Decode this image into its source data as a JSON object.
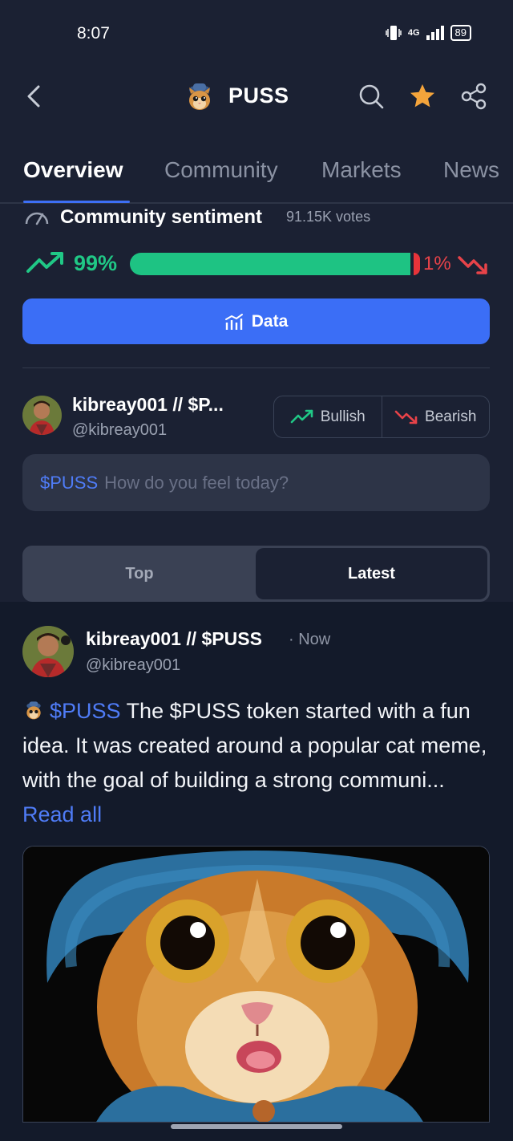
{
  "status_bar": {
    "time": "8:07",
    "network": "4G",
    "battery": "89"
  },
  "header": {
    "coin_name": "PUSS"
  },
  "tabs": [
    {
      "label": "Overview",
      "active": true
    },
    {
      "label": "Community",
      "active": false
    },
    {
      "label": "Markets",
      "active": false
    },
    {
      "label": "News",
      "active": false
    }
  ],
  "sentiment": {
    "title": "Community sentiment",
    "votes": "91.15K votes",
    "bullish_pct": "99%",
    "bearish_pct": "1%",
    "bullish_fraction": 0.99,
    "bullish_color": "#1ec383",
    "bearish_color": "#e8343a"
  },
  "data_button": {
    "label": "Data"
  },
  "composer": {
    "user_name": "kibreay001 // $P...",
    "user_handle": "@kibreay001",
    "bullish_label": "Bullish",
    "bearish_label": "Bearish",
    "cashtag": "$PUSS",
    "placeholder": "How do you feel today?"
  },
  "feed_toggle": {
    "top_label": "Top",
    "latest_label": "Latest",
    "selected": "Latest"
  },
  "post": {
    "author": "kibreay001 // $PUSS",
    "time": "· Now",
    "handle": "@kibreay001",
    "cashtag": "$PUSS",
    "text": "The $PUSS token started with a fun idea. It was created around a popular cat meme, with the goal of building a strong communi...",
    "read_all": "Read all"
  },
  "colors": {
    "accent": "#3b6ef6",
    "bull": "#20c886",
    "bear": "#e84349",
    "star": "#f4a43b"
  }
}
